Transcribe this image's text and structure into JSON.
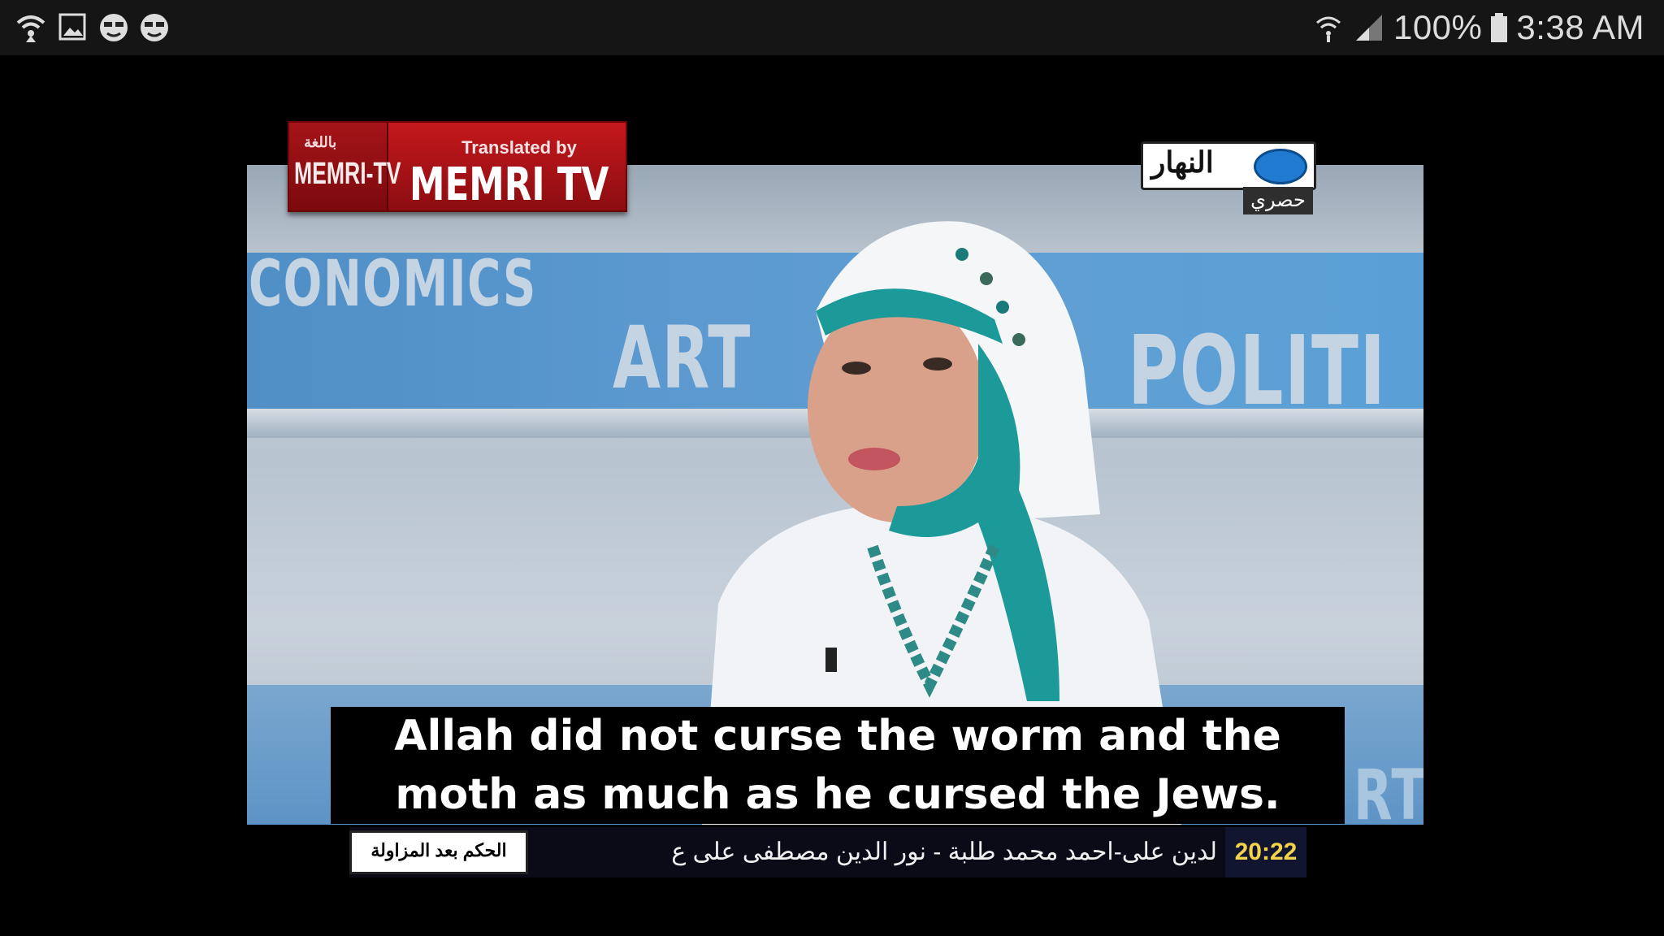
{
  "status_bar": {
    "left_icons": [
      "wifi-icon",
      "image-icon",
      "face-icon",
      "face-icon"
    ],
    "battery_text": "100%",
    "time": "3:38 AM",
    "right_icons": [
      "wifi-icon",
      "signal-icon",
      "battery-icon"
    ]
  },
  "video": {
    "wall_words": [
      "CONOMICS",
      "ART",
      "POLITI",
      "RT"
    ],
    "memri": {
      "small_text": "باللغة",
      "left_logo": "MEMRI-TV",
      "translated_by": "Translated by",
      "name": "MEMRI TV"
    },
    "channel": {
      "name": "النهار",
      "sub": "حصري"
    },
    "subtitle": {
      "line1": "Allah did not curse the worm and the",
      "line2": "moth as much as he cursed the Jews."
    },
    "ticker": {
      "label": "الحكم بعد المزاولة",
      "text": "لدين على-احمد محمد طلبة - نور الدين مصطفى على ع",
      "time": "20:22"
    }
  },
  "colors": {
    "background": "#000000",
    "status_bar": "#151515",
    "memri_red": "#c4181d",
    "teal_scarf": "#1c9a9a",
    "ticker_time": "#f2d34a"
  }
}
